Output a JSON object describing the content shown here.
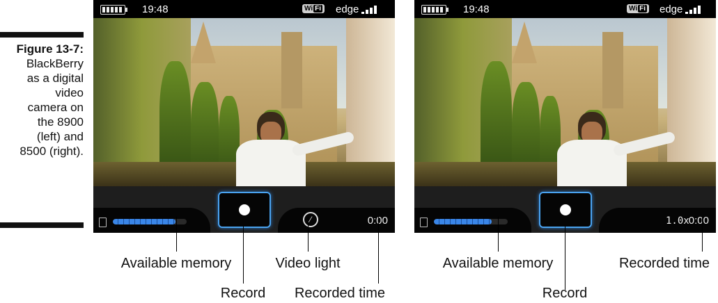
{
  "caption": {
    "figure_number": "Figure 13-7:",
    "text": "BlackBerry\nas a digital\nvideo\ncamera on\nthe 8900\n(left) and\n8500 (right)."
  },
  "screens": [
    {
      "status": {
        "time": "19:48",
        "wifi_left": "Wi",
        "wifi_right": "Fi",
        "network": "edge"
      },
      "controls": {
        "memory_fill": 0.85,
        "record_time": "0:00"
      },
      "callouts": {
        "memory": "Available memory",
        "record": "Record",
        "light": "Video light",
        "time": "Recorded time"
      },
      "icons": {
        "memory": "sd-card-icon",
        "record": "record-dot-icon",
        "light": "flash-off-icon"
      }
    },
    {
      "status": {
        "time": "19:48",
        "wifi_left": "Wi",
        "wifi_right": "Fi",
        "network": "edge"
      },
      "controls": {
        "memory_fill": 0.78,
        "zoom": "1.0x",
        "record_time": "0:00"
      },
      "callouts": {
        "memory": "Available memory",
        "record": "Record",
        "time": "Recorded time"
      },
      "icons": {
        "memory": "sd-card-icon",
        "record": "record-dot-icon"
      }
    }
  ],
  "colors": {
    "accent": "#4aa3f0",
    "memory_bar": "#3a86e8"
  }
}
